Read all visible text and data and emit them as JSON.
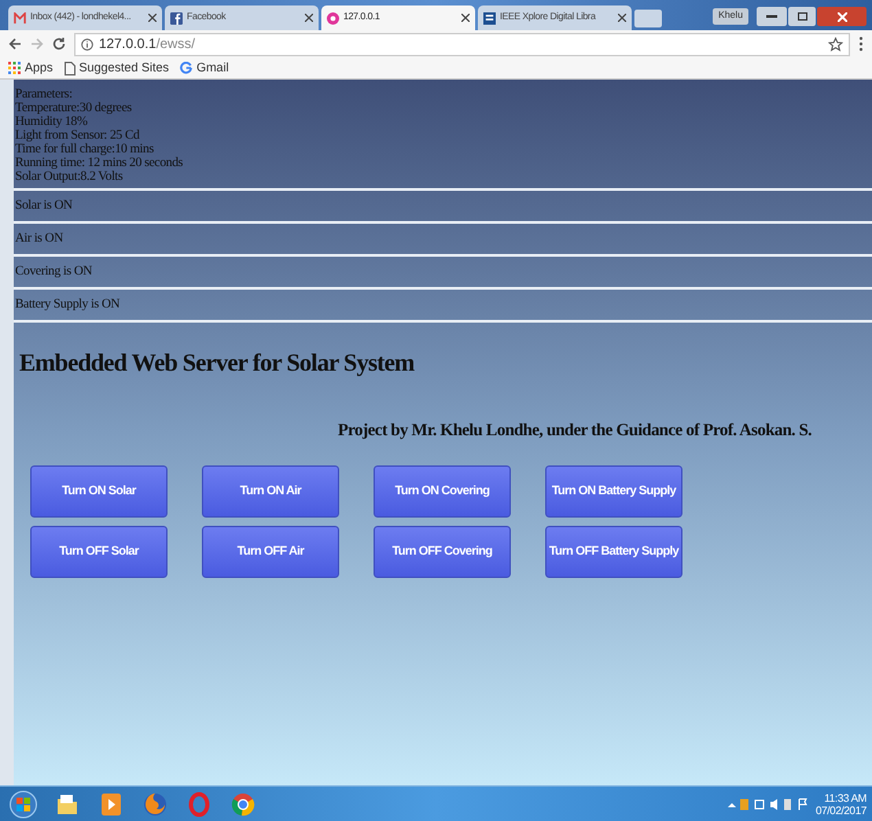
{
  "browser": {
    "tabs": [
      {
        "title": "Inbox (442) - londhekel4...",
        "selected": false
      },
      {
        "title": "Facebook",
        "selected": false
      },
      {
        "title": "127.0.0.1",
        "selected": true
      },
      {
        "title": "IEEE Xplore Digital Libra",
        "selected": false
      }
    ],
    "profile": "Khelu",
    "address": {
      "host": "127.0.0.1",
      "path": "/ewss/"
    },
    "bookmarks": [
      "Apps",
      "Suggested Sites",
      "Gmail"
    ]
  },
  "page": {
    "parameters": [
      "Parameters:",
      "Temperature:30 degrees",
      "Humidity 18%",
      "Light from Sensor: 25 Cd",
      "Time for full charge:10 mins",
      "Running time: 12 mins 20 seconds",
      "Solar Output:8.2 Volts"
    ],
    "statuses": [
      "Solar is ON",
      "Air is ON",
      "Covering is ON",
      "Battery Supply is ON"
    ],
    "title": "Embedded Web Server for Solar System",
    "credit": "Project by Mr. Khelu Londhe, under the Guidance of Prof. Asokan. S.",
    "buttons": [
      [
        "Turn ON Solar",
        "Turn ON Air",
        "Turn ON Covering",
        "Turn ON Battery Supply"
      ],
      [
        "Turn OFF Solar",
        "Turn OFF Air",
        "Turn OFF Covering",
        "Turn OFF Battery Supply"
      ]
    ]
  },
  "taskbar": {
    "time": "11:33 AM",
    "date": "07/02/2017"
  }
}
